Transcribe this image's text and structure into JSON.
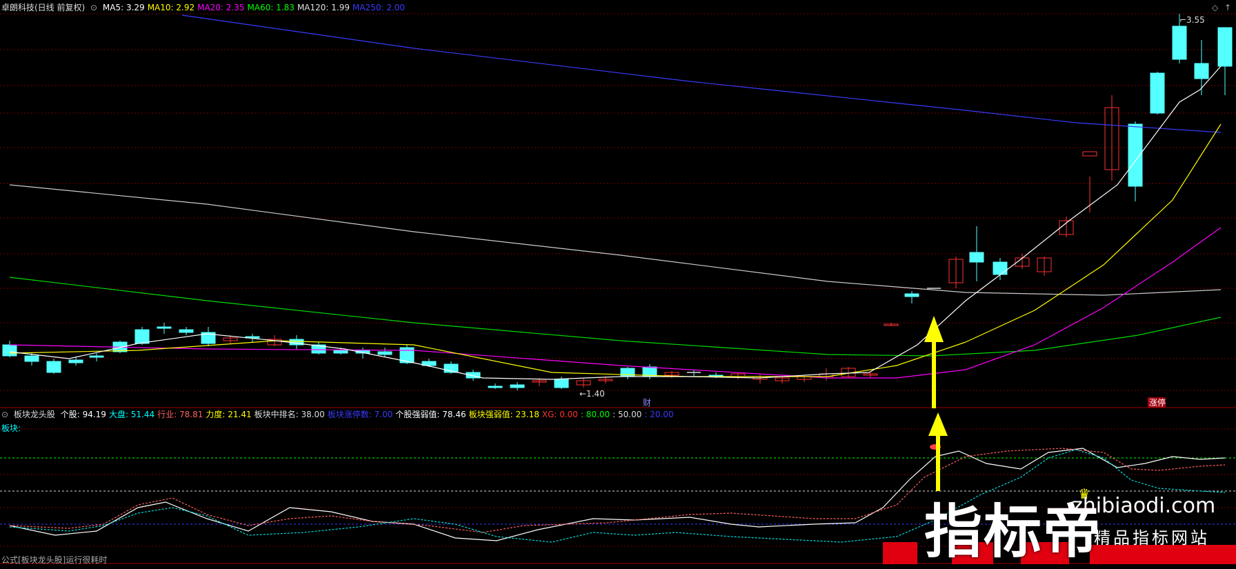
{
  "main": {
    "title": "卓朗科技(日线 前复权)",
    "ma": [
      {
        "label": "MA5: 3.29",
        "color": "#ffffff"
      },
      {
        "label": "MA10: 2.92",
        "color": "#ffff00"
      },
      {
        "label": "MA20: 2.35",
        "color": "#ff00ff"
      },
      {
        "label": "MA60: 1.83",
        "color": "#00ff00"
      },
      {
        "label": "MA120: 1.99",
        "color": "#e0e0e0"
      },
      {
        "label": "MA250: 2.00",
        "color": "#3a3aff"
      }
    ],
    "high_label": "3.55",
    "low_label": "1.40",
    "marker_fin": "财",
    "marker_limit": "涨停",
    "corner_icons": [
      "diamond-icon",
      "up-arrow-icon"
    ]
  },
  "sub": {
    "title": "板块龙头股",
    "fields": [
      {
        "label": "个股: 94.19",
        "color": "#ffffff"
      },
      {
        "label": "大盘: 51.44",
        "color": "#00ffff"
      },
      {
        "label": "行业: 78.81",
        "color": "#ff6060"
      },
      {
        "label": "力度: 21.41",
        "color": "#ffff00"
      },
      {
        "label": "板块中排名: 38.00",
        "color": "#dddddd"
      },
      {
        "label": "板块涨停数: 7.00",
        "color": "#3a3aff"
      },
      {
        "label": "个股强弱值: 78.46",
        "color": "#ffffff"
      },
      {
        "label": "板块强弱值: 23.18",
        "color": "#ffff00"
      },
      {
        "label": "XG: 0.00",
        "color": "#ff3030"
      },
      {
        "label": ": 80.00",
        "color": "#00ff00"
      },
      {
        "label": ": 50.00",
        "color": "#dddddd"
      },
      {
        "label": ": 20.00",
        "color": "#3a3aff"
      }
    ],
    "sector_label": "板块:"
  },
  "status": "公式[板块龙头股]运行很耗时",
  "watermark": {
    "main": "指标帝",
    "url": "zhibiaodi.com",
    "sub": "精品指标网站"
  },
  "colors": {
    "up": "#ff3232",
    "down": "#54ffff",
    "grid": "#7a0000",
    "arrow": "#ffff00"
  }
}
